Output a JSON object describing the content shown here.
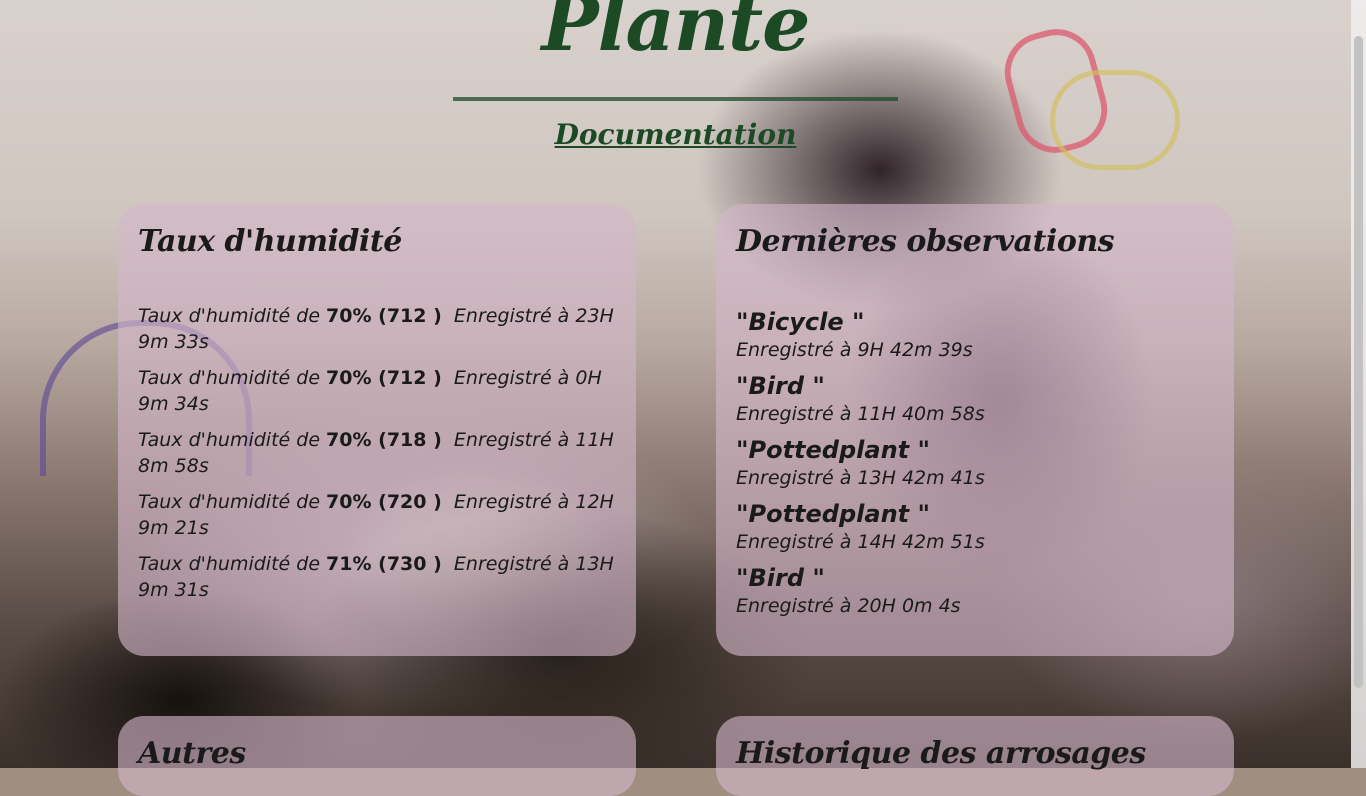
{
  "header": {
    "title": "Plante",
    "doc_link": "Documentation"
  },
  "humidity": {
    "title": "Taux d'humidité",
    "items": [
      {
        "prefix": "Taux d'humidité de ",
        "value": "70% (712 )",
        "time": "Enregistré à 23H 9m 33s"
      },
      {
        "prefix": "Taux d'humidité de ",
        "value": "70% (712 )",
        "time": "Enregistré à 0H 9m 34s"
      },
      {
        "prefix": "Taux d'humidité de ",
        "value": "70% (718 )",
        "time": "Enregistré à 11H 8m 58s"
      },
      {
        "prefix": "Taux d'humidité de ",
        "value": "70% (720 )",
        "time": "Enregistré à 12H 9m 21s"
      },
      {
        "prefix": "Taux d'humidité de ",
        "value": "71% (730 )",
        "time": "Enregistré à 13H 9m 31s"
      }
    ]
  },
  "observations": {
    "title": "Dernières observations",
    "items": [
      {
        "name": "\"Bicycle \"",
        "time": "Enregistré à 9H 42m 39s"
      },
      {
        "name": "\"Bird \"",
        "time": "Enregistré à 11H 40m 58s"
      },
      {
        "name": "\"Pottedplant \"",
        "time": "Enregistré à 13H 42m 41s"
      },
      {
        "name": "\"Pottedplant \"",
        "time": "Enregistré à 14H 42m 51s"
      },
      {
        "name": "\"Bird \"",
        "time": "Enregistré à 20H 0m 4s"
      }
    ]
  },
  "others": {
    "title": "Autres"
  },
  "watering": {
    "title": "Historique des arrosages"
  }
}
